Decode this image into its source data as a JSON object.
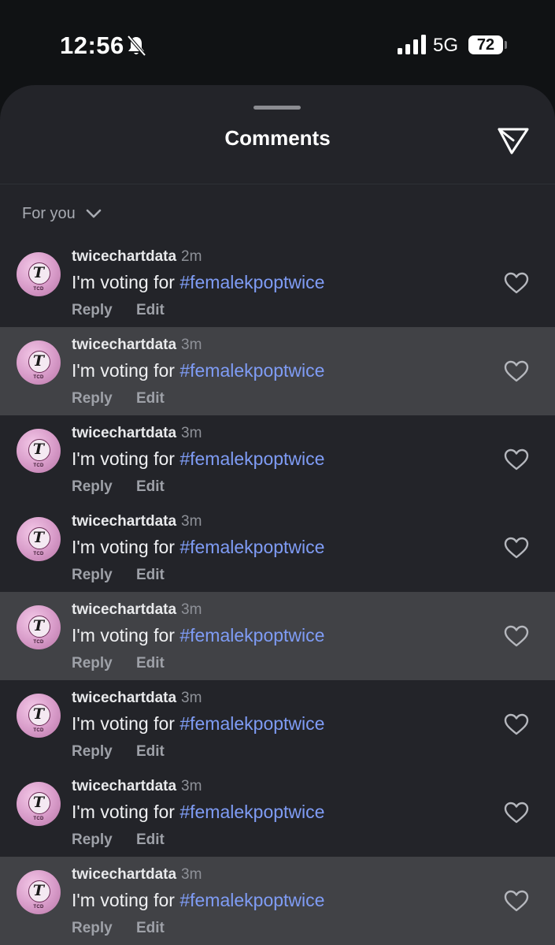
{
  "status_bar": {
    "time": "12:56",
    "network": "5G",
    "battery": "72",
    "icons": [
      "bell-slash-icon",
      "signal-bars-icon",
      "battery-icon"
    ]
  },
  "sheet": {
    "title": "Comments",
    "share_icon": "send-icon",
    "filter_label": "For you",
    "filter_icon": "chevron-down-icon"
  },
  "colors": {
    "sheet_bg": "#232429",
    "highlight_row_bg": "#414246",
    "hashtag": "#7f9cf5"
  },
  "comments": [
    {
      "user": "twicechartdata",
      "ago": "2m",
      "text": "I'm voting for ",
      "hashtag": "#femalekpoptwice",
      "reply": "Reply",
      "edit": "Edit",
      "highlighted": false
    },
    {
      "user": "twicechartdata",
      "ago": "3m",
      "text": "I'm voting for ",
      "hashtag": "#femalekpoptwice",
      "reply": "Reply",
      "edit": "Edit",
      "highlighted": true
    },
    {
      "user": "twicechartdata",
      "ago": "3m",
      "text": "I'm voting for ",
      "hashtag": "#femalekpoptwice",
      "reply": "Reply",
      "edit": "Edit",
      "highlighted": false
    },
    {
      "user": "twicechartdata",
      "ago": "3m",
      "text": "I'm voting for ",
      "hashtag": "#femalekpoptwice",
      "reply": "Reply",
      "edit": "Edit",
      "highlighted": false
    },
    {
      "user": "twicechartdata",
      "ago": "3m",
      "text": "I'm voting for ",
      "hashtag": "#femalekpoptwice",
      "reply": "Reply",
      "edit": "Edit",
      "highlighted": true
    },
    {
      "user": "twicechartdata",
      "ago": "3m",
      "text": "I'm voting for ",
      "hashtag": "#femalekpoptwice",
      "reply": "Reply",
      "edit": "Edit",
      "highlighted": false
    },
    {
      "user": "twicechartdata",
      "ago": "3m",
      "text": "I'm voting for ",
      "hashtag": "#femalekpoptwice",
      "reply": "Reply",
      "edit": "Edit",
      "highlighted": false
    },
    {
      "user": "twicechartdata",
      "ago": "3m",
      "text": "I'm voting for ",
      "hashtag": "#femalekpoptwice",
      "reply": "Reply",
      "edit": "Edit",
      "highlighted": true
    }
  ],
  "avatar": {
    "logo": "T",
    "tag": "TCD"
  }
}
